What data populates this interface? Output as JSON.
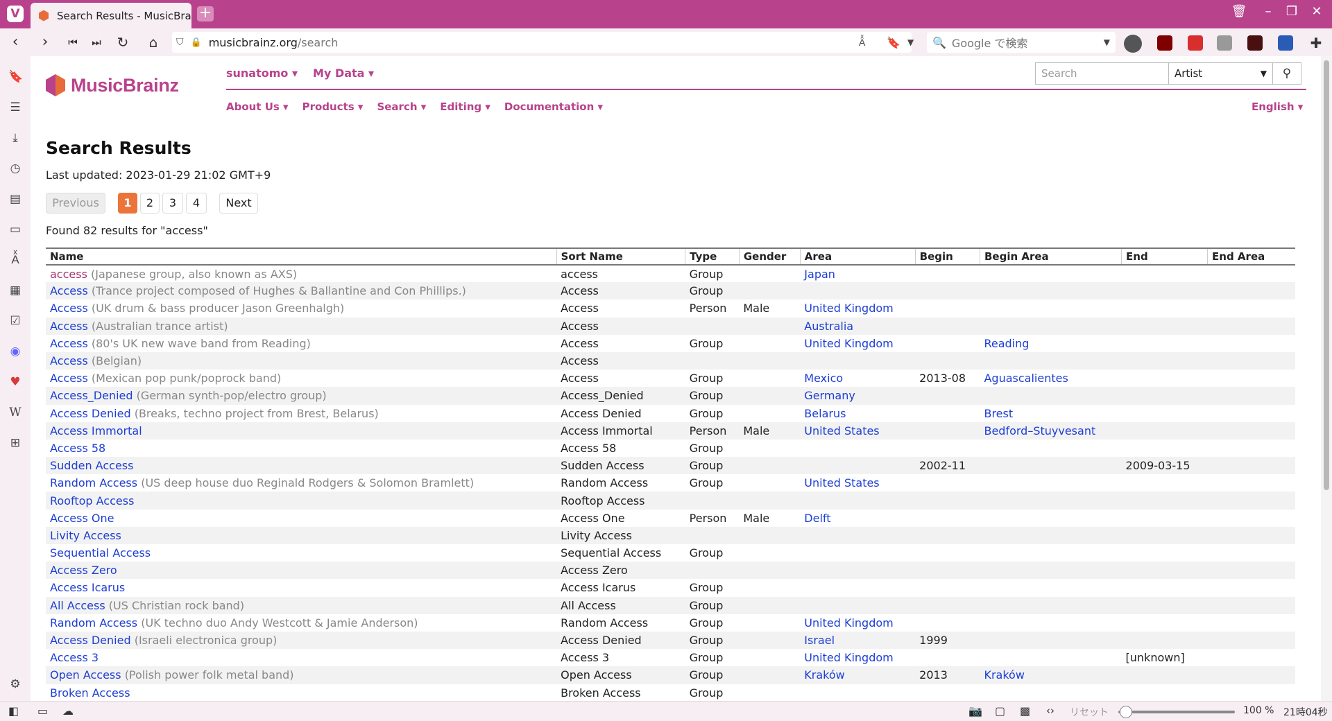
{
  "browser": {
    "tab_title": "Search Results - MusicBrainz",
    "url_host": "musicbrainz.org",
    "url_path": "/search",
    "search_placeholder": "Google で検索",
    "status": {
      "reset": "リセット",
      "zoom": "100 %",
      "clock": "21時04秒"
    }
  },
  "site": {
    "logo_text": "MusicBrainz",
    "user_menu": [
      "sunatomo ▾",
      "My Data ▾"
    ],
    "main_menu": [
      "About Us ▾",
      "Products ▾",
      "Search ▾",
      "Editing ▾",
      "Documentation ▾"
    ],
    "language": "English ▾",
    "header_search": {
      "placeholder": "Search",
      "type": "Artist"
    }
  },
  "page": {
    "title": "Search Results",
    "last_updated": "Last updated: 2023-01-29 21:02 GMT+9",
    "pager": {
      "previous": "Previous",
      "pages": [
        "1",
        "2",
        "3",
        "4"
      ],
      "next": "Next"
    },
    "found": "Found 82 results for \"access\""
  },
  "table": {
    "headers": [
      "Name",
      "Sort Name",
      "Type",
      "Gender",
      "Area",
      "Begin",
      "Begin Area",
      "End",
      "End Area"
    ],
    "rows": [
      {
        "name": "access",
        "comment": "(Japanese group, also known as AXS)",
        "sort": "access",
        "type": "Group",
        "gender": "",
        "area": "Japan",
        "begin": "",
        "begin_area": "",
        "end": "",
        "end_area": "",
        "visited": true
      },
      {
        "name": "Access",
        "comment": "(Trance project composed of Hughes & Ballantine and Con Phillips.)",
        "sort": "Access",
        "type": "Group",
        "gender": "",
        "area": "",
        "begin": "",
        "begin_area": "",
        "end": "",
        "end_area": ""
      },
      {
        "name": "Access",
        "comment": "(UK drum & bass producer Jason Greenhalgh)",
        "sort": "Access",
        "type": "Person",
        "gender": "Male",
        "area": "United Kingdom",
        "begin": "",
        "begin_area": "",
        "end": "",
        "end_area": ""
      },
      {
        "name": "Access",
        "comment": "(Australian trance artist)",
        "sort": "Access",
        "type": "",
        "gender": "",
        "area": "Australia",
        "begin": "",
        "begin_area": "",
        "end": "",
        "end_area": ""
      },
      {
        "name": "Access",
        "comment": "(80's UK new wave band from Reading)",
        "sort": "Access",
        "type": "Group",
        "gender": "",
        "area": "United Kingdom",
        "begin": "",
        "begin_area": "Reading",
        "end": "",
        "end_area": ""
      },
      {
        "name": "Access",
        "comment": "(Belgian)",
        "sort": "Access",
        "type": "",
        "gender": "",
        "area": "",
        "begin": "",
        "begin_area": "",
        "end": "",
        "end_area": ""
      },
      {
        "name": "Access",
        "comment": "(Mexican pop punk/poprock band)",
        "sort": "Access",
        "type": "Group",
        "gender": "",
        "area": "Mexico",
        "begin": "2013-08",
        "begin_area": "Aguascalientes",
        "end": "",
        "end_area": ""
      },
      {
        "name": "Access_Denied",
        "comment": "(German synth-pop/electro group)",
        "sort": "Access_Denied",
        "type": "Group",
        "gender": "",
        "area": "Germany",
        "begin": "",
        "begin_area": "",
        "end": "",
        "end_area": ""
      },
      {
        "name": "Access Denied",
        "comment": "(Breaks, techno project from Brest, Belarus)",
        "sort": "Access Denied",
        "type": "Group",
        "gender": "",
        "area": "Belarus",
        "begin": "",
        "begin_area": "Brest",
        "end": "",
        "end_area": ""
      },
      {
        "name": "Access Immortal",
        "comment": "",
        "sort": "Access Immortal",
        "type": "Person",
        "gender": "Male",
        "area": "United States",
        "begin": "",
        "begin_area": "Bedford–Stuyvesant",
        "end": "",
        "end_area": ""
      },
      {
        "name": "Access 58",
        "comment": "",
        "sort": "Access 58",
        "type": "Group",
        "gender": "",
        "area": "",
        "begin": "",
        "begin_area": "",
        "end": "",
        "end_area": ""
      },
      {
        "name": "Sudden Access",
        "comment": "",
        "sort": "Sudden Access",
        "type": "Group",
        "gender": "",
        "area": "",
        "begin": "2002-11",
        "begin_area": "",
        "end": "2009-03-15",
        "end_area": ""
      },
      {
        "name": "Random Access",
        "comment": "(US deep house duo Reginald Rodgers & Solomon Bramlett)",
        "sort": "Random Access",
        "type": "Group",
        "gender": "",
        "area": "United States",
        "begin": "",
        "begin_area": "",
        "end": "",
        "end_area": ""
      },
      {
        "name": "Rooftop Access",
        "comment": "",
        "sort": "Rooftop Access",
        "type": "",
        "gender": "",
        "area": "",
        "begin": "",
        "begin_area": "",
        "end": "",
        "end_area": ""
      },
      {
        "name": "Access One",
        "comment": "",
        "sort": "Access One",
        "type": "Person",
        "gender": "Male",
        "area": "Delft",
        "begin": "",
        "begin_area": "",
        "end": "",
        "end_area": ""
      },
      {
        "name": "Livity Access",
        "comment": "",
        "sort": "Livity Access",
        "type": "",
        "gender": "",
        "area": "",
        "begin": "",
        "begin_area": "",
        "end": "",
        "end_area": ""
      },
      {
        "name": "Sequential Access",
        "comment": "",
        "sort": "Sequential Access",
        "type": "Group",
        "gender": "",
        "area": "",
        "begin": "",
        "begin_area": "",
        "end": "",
        "end_area": ""
      },
      {
        "name": "Access Zero",
        "comment": "",
        "sort": "Access Zero",
        "type": "",
        "gender": "",
        "area": "",
        "begin": "",
        "begin_area": "",
        "end": "",
        "end_area": ""
      },
      {
        "name": "Access Icarus",
        "comment": "",
        "sort": "Access Icarus",
        "type": "Group",
        "gender": "",
        "area": "",
        "begin": "",
        "begin_area": "",
        "end": "",
        "end_area": ""
      },
      {
        "name": "All Access",
        "comment": "(US Christian rock band)",
        "sort": "All Access",
        "type": "Group",
        "gender": "",
        "area": "",
        "begin": "",
        "begin_area": "",
        "end": "",
        "end_area": ""
      },
      {
        "name": "Random Access",
        "comment": "(UK techno duo Andy Westcott & Jamie Anderson)",
        "sort": "Random Access",
        "type": "Group",
        "gender": "",
        "area": "United Kingdom",
        "begin": "",
        "begin_area": "",
        "end": "",
        "end_area": ""
      },
      {
        "name": "Access Denied",
        "comment": "(Israeli electronica group)",
        "sort": "Access Denied",
        "type": "Group",
        "gender": "",
        "area": "Israel",
        "begin": "1999",
        "begin_area": "",
        "end": "",
        "end_area": ""
      },
      {
        "name": "Access 3",
        "comment": "",
        "sort": "Access 3",
        "type": "Group",
        "gender": "",
        "area": "United Kingdom",
        "begin": "",
        "begin_area": "",
        "end": "[unknown]",
        "end_area": ""
      },
      {
        "name": "Open Access",
        "comment": "(Polish power folk metal band)",
        "sort": "Open Access",
        "type": "Group",
        "gender": "",
        "area": "Kraków",
        "begin": "2013",
        "begin_area": "Kraków",
        "end": "",
        "end_area": ""
      },
      {
        "name": "Broken Access",
        "comment": "",
        "sort": "Broken Access",
        "type": "Group",
        "gender": "",
        "area": "",
        "begin": "",
        "begin_area": "",
        "end": "",
        "end_area": ""
      }
    ]
  }
}
